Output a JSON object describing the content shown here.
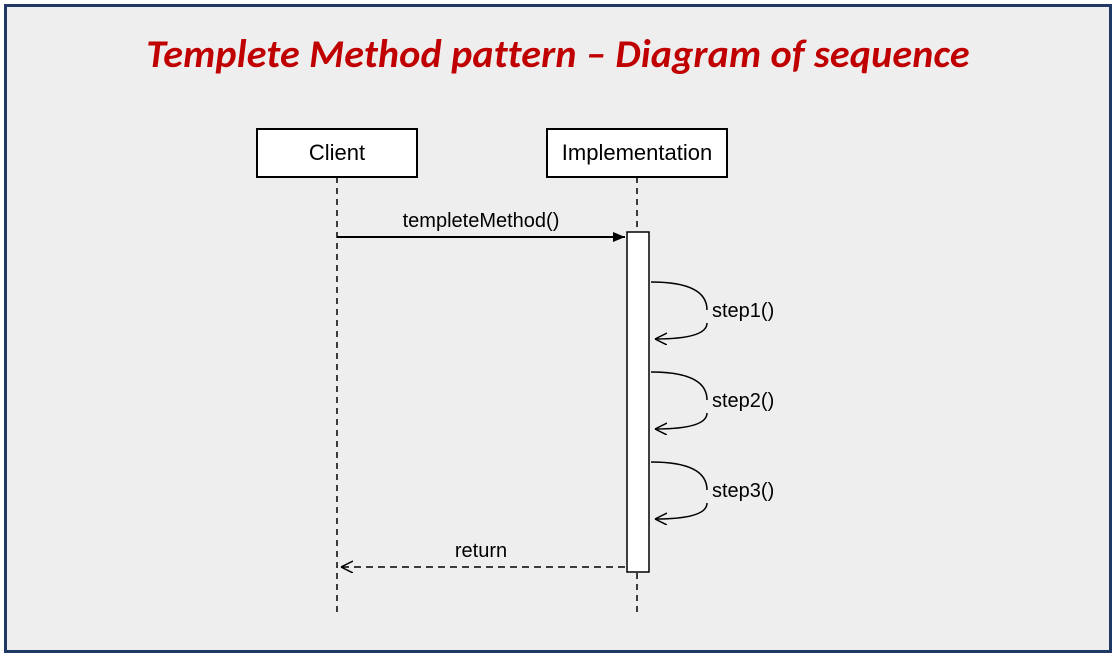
{
  "title": "Templete Method pattern – Diagram of sequence",
  "participants": {
    "client": "Client",
    "implementation": "Implementation"
  },
  "messages": {
    "call": "templeteMethod()",
    "return": "return"
  },
  "selfcalls": [
    "step1()",
    "step2()",
    "step3()"
  ]
}
